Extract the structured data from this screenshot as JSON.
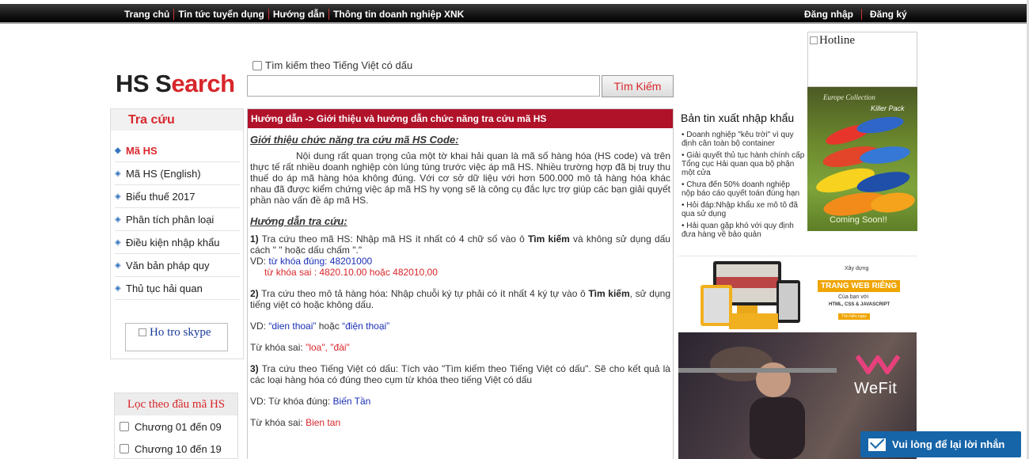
{
  "topnav": {
    "items": [
      "Trang chủ",
      "Tin tức tuyển dụng",
      "Hướng dẫn",
      "Thông tin doanh nghiệp XNK"
    ],
    "login": "Đăng nhập",
    "register": "Đăng ký"
  },
  "logo": {
    "part1": "HS S",
    "part2": "earch"
  },
  "search": {
    "checkbox_label": "Tìm kiếm theo Tiếng Việt có dấu",
    "input_value": "",
    "button_label": "Tìm Kiếm"
  },
  "sidebar": {
    "title": "Tra cứu",
    "items": [
      {
        "label": "Mã HS"
      },
      {
        "label": "Mã HS (English)"
      },
      {
        "label": "Biểu thuế 2017"
      },
      {
        "label": "Phân tích phân loại"
      },
      {
        "label": "Điều kiện nhập khẩu"
      },
      {
        "label": "Văn bản pháp quy"
      },
      {
        "label": "Thủ tục hải quan"
      }
    ],
    "skype_alt": "Ho tro skype"
  },
  "filter": {
    "title": "Lọc theo đầu mã HS",
    "items": [
      "Chương 01 đến 09",
      "Chương 10 đến 19"
    ]
  },
  "main": {
    "header": "Hướng dẫn -> Giới thiệu và hướng dẫn chức năng tra cứu mã HS",
    "intro_heading": "Giới thiệu chức năng tra cứu mã HS Code:",
    "intro_text": "Nội dung rất quan trọng của một tờ khai hải quan là mã số hàng hóa (HS code) và trên thực tế rất nhiều doanh nghiệp còn lúng túng trước việc áp mã HS. Nhiều trường hợp đã bị truy thu thuế do áp mã hàng hóa không đúng. Với cơ sở dữ liệu với hơn 500.000 mô tả hàng hóa khác nhau đã được kiểm chứng việc áp mã HS hy vọng sẽ là công cụ đắc lực trợ giúp các bạn giải quyết phần nào vấn đề áp mã HS.",
    "guide_heading": "Hướng dẫn tra cứu:",
    "s1_num": "1)",
    "s1_a": "Tra cứu theo mã HS: Nhập mã HS ít nhất có 4 chữ số vào ô",
    "s1_bold": "Tìm kiếm",
    "s1_b": "và không sử dụng dấu cách \" \" hoặc dấu chấm \".\"",
    "s1_vd": "VD:",
    "s1_ok": "từ khóa đúng: 48201000",
    "s1_bad": "từ khóa sai   : 4820.10.00 hoặc 482010,00",
    "s2_num": "2)",
    "s2_a": "Tra cứu theo mô tả hàng hóa: Nhập chuỗi ký tự phải có ít nhất 4 ký tự vào ô",
    "s2_bold": "Tìm kiếm",
    "s2_b": ", sử dụng tiếng việt có hoặc không dấu.",
    "s2_vd": "VD:",
    "s2_ex1": "“dien thoai”",
    "s2_or": "hoặc",
    "s2_ex2": "“điện thoại”",
    "s2_bad_label": "Từ khóa sai:",
    "s2_bad": "\"loa\", \"đài\"",
    "s3_num": "3)",
    "s3_text": "Tra cứu theo Tiếng Việt có dấu: Tích vào \"Tìm kiếm theo Tiếng Việt có dấu\". Sẽ cho kết quả là các loại hàng hóa có đúng theo cụm từ khóa theo tiếng Việt có dấu",
    "s3_ok_label": "VD: Từ khóa đúng:",
    "s3_ok": "Biến Tần",
    "s3_bad_label": "Từ khóa sai:",
    "s3_bad": "Bien tan"
  },
  "news": {
    "title": "Bản tin xuất nhập khẩu",
    "items": [
      "• Doanh nghiệp \"kêu trời\" vì quy định cân toàn bộ container",
      "• Giải quyết thủ tục hành chính cấp Tổng cục Hải quan qua bộ phận một cửa",
      "• Chưa đến 50% doanh nghiệp nộp báo cáo quyết toán đúng hạn",
      "• Hỏi đáp:Nhập khẩu xe mô tô đã qua sử dụng",
      "• Hải quan gặp khó với quy định đưa hàng về bảo quản"
    ]
  },
  "hotline_alt": "Hotline",
  "ads": {
    "ad1_collection": "Europe Collection",
    "ad1_brand": "Killer Pack",
    "ad1_coming": "Coming Soon!!",
    "ad2_xaydung": "Xây dựng",
    "ad2_title": "TRANG WEB RIÊNG",
    "ad2_sub": "Của bạn với",
    "ad2_tech": "HTML, CSS & JAVASCRIPT",
    "ad2_btn": "Tìm hiểu ngay",
    "ad3_brand": "WeFit"
  },
  "chat": {
    "label": "Vui lòng để lại lời nhắn"
  },
  "colors": {
    "brand_red": "#d8262b",
    "header_red": "#b0122a",
    "chat_blue": "#1665a8"
  }
}
